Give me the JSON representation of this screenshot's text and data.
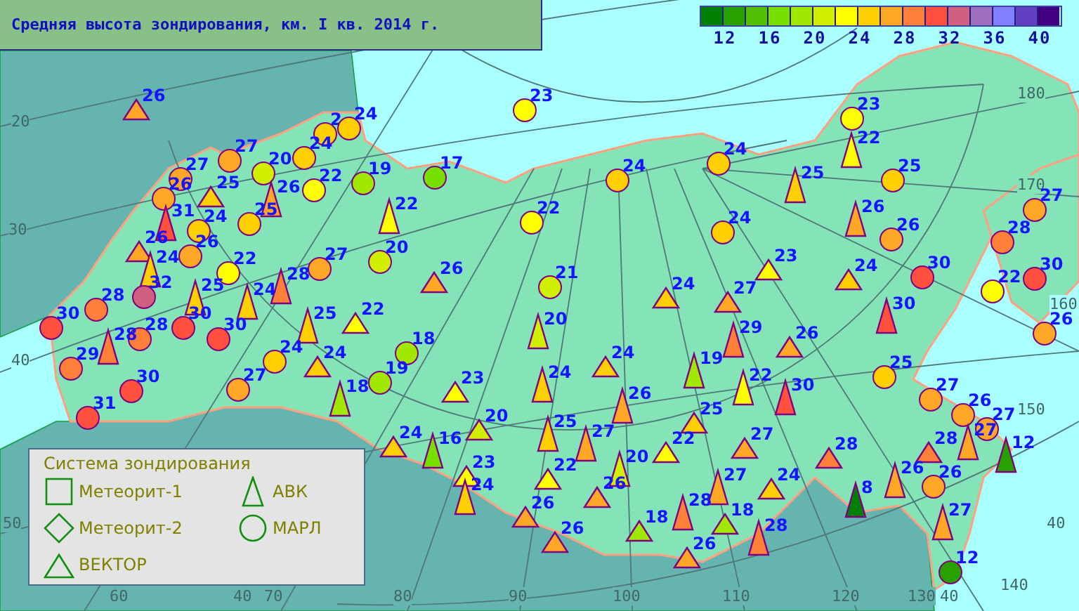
{
  "title": "Средняя высота зондирования, км. I кв. 2014 г.",
  "color_scale": {
    "swatches": [
      {
        "color": "#008000"
      },
      {
        "color": "#28a000"
      },
      {
        "color": "#50c000"
      },
      {
        "color": "#78e000"
      },
      {
        "color": "#a0e800"
      },
      {
        "color": "#d0f000"
      },
      {
        "color": "#ffff00"
      },
      {
        "color": "#ffd000"
      },
      {
        "color": "#ffa828"
      },
      {
        "color": "#ff8038"
      },
      {
        "color": "#ff5040"
      },
      {
        "color": "#d06080"
      },
      {
        "color": "#a070c0"
      },
      {
        "color": "#8080ff"
      },
      {
        "color": "#6040c0"
      },
      {
        "color": "#400080"
      }
    ],
    "labels": [
      "12",
      "16",
      "20",
      "24",
      "28",
      "32",
      "36",
      "40"
    ]
  },
  "grid_labels": [
    "20",
    "30",
    "40",
    "50",
    "60",
    "40",
    "70",
    "80",
    "90",
    "100",
    "110",
    "120",
    "130",
    "40",
    "180",
    "170",
    "160",
    "150",
    "140",
    "40"
  ],
  "stations": [
    {
      "kind": "vektor",
      "value": "26",
      "color": "#ffa828"
    },
    {
      "kind": "marl",
      "value": "2",
      "color": "#ffd000"
    },
    {
      "kind": "marl",
      "value": "24",
      "color": "#ffd000"
    },
    {
      "kind": "marl",
      "value": "23",
      "color": "#ffff00"
    },
    {
      "kind": "marl",
      "value": "27",
      "color": "#ffa828"
    },
    {
      "kind": "marl",
      "value": "20",
      "color": "#d0f000"
    },
    {
      "kind": "marl",
      "value": "24",
      "color": "#ffd000"
    },
    {
      "kind": "marl",
      "value": "27",
      "color": "#ffa828"
    },
    {
      "kind": "marl",
      "value": "26",
      "color": "#ffa828"
    },
    {
      "kind": "vektor",
      "value": "25",
      "color": "#ffd000"
    },
    {
      "kind": "avk",
      "value": "26",
      "color": "#ffa828"
    },
    {
      "kind": "marl",
      "value": "22",
      "color": "#ffff00"
    },
    {
      "kind": "marl",
      "value": "19",
      "color": "#a0e800"
    },
    {
      "kind": "marl",
      "value": "17",
      "color": "#78e000"
    },
    {
      "kind": "avk",
      "value": "31",
      "color": "#ff5040"
    },
    {
      "kind": "marl",
      "value": "24",
      "color": "#ffd000"
    },
    {
      "kind": "marl",
      "value": "25",
      "color": "#ffd000"
    },
    {
      "kind": "avk",
      "value": "22",
      "color": "#ffff00"
    },
    {
      "kind": "marl",
      "value": "22",
      "color": "#ffff00"
    },
    {
      "kind": "vektor",
      "value": "26",
      "color": "#ffa828"
    },
    {
      "kind": "marl",
      "value": "26",
      "color": "#ffa828"
    },
    {
      "kind": "avk",
      "value": "24",
      "color": "#ffd000"
    },
    {
      "kind": "marl",
      "value": "22",
      "color": "#ffff00"
    },
    {
      "kind": "marl",
      "value": "27",
      "color": "#ffa828"
    },
    {
      "kind": "marl",
      "value": "20",
      "color": "#d0f000"
    },
    {
      "kind": "avk",
      "value": "28",
      "color": "#ff8038"
    },
    {
      "kind": "vektor",
      "value": "26",
      "color": "#ffa828"
    },
    {
      "kind": "marl",
      "value": "32",
      "color": "#d06080"
    },
    {
      "kind": "avk",
      "value": "25",
      "color": "#ffd000"
    },
    {
      "kind": "avk",
      "value": "24",
      "color": "#ffd000"
    },
    {
      "kind": "marl",
      "value": "28",
      "color": "#ff8038"
    },
    {
      "kind": "marl",
      "value": "30",
      "color": "#ff5040"
    },
    {
      "kind": "marl",
      "value": "28",
      "color": "#ff8038"
    },
    {
      "kind": "marl",
      "value": "30",
      "color": "#ff5040"
    },
    {
      "kind": "marl",
      "value": "30",
      "color": "#ff5040"
    },
    {
      "kind": "avk",
      "value": "25",
      "color": "#ffd000"
    },
    {
      "kind": "vektor",
      "value": "22",
      "color": "#ffff00"
    },
    {
      "kind": "marl",
      "value": "29",
      "color": "#ff8038"
    },
    {
      "kind": "avk",
      "value": "28",
      "color": "#ff8038"
    },
    {
      "kind": "marl",
      "value": "24",
      "color": "#ffd000"
    },
    {
      "kind": "vektor",
      "value": "24",
      "color": "#ffd000"
    },
    {
      "kind": "marl",
      "value": "18",
      "color": "#a0e800"
    },
    {
      "kind": "marl",
      "value": "30",
      "color": "#ff5040"
    },
    {
      "kind": "marl",
      "value": "27",
      "color": "#ffa828"
    },
    {
      "kind": "marl",
      "value": "19",
      "color": "#a0e800"
    },
    {
      "kind": "avk",
      "value": "18",
      "color": "#a0e800"
    },
    {
      "kind": "vektor",
      "value": "23",
      "color": "#ffff00"
    },
    {
      "kind": "marl",
      "value": "31",
      "color": "#ff5040"
    },
    {
      "kind": "vektor",
      "value": "24",
      "color": "#ffd000"
    },
    {
      "kind": "avk",
      "value": "16",
      "color": "#78e000"
    },
    {
      "kind": "vektor",
      "value": "20",
      "color": "#d0f000"
    },
    {
      "kind": "vektor",
      "value": "23",
      "color": "#ffff00"
    },
    {
      "kind": "avk",
      "value": "24",
      "color": "#ffd000"
    },
    {
      "kind": "vektor",
      "value": "26",
      "color": "#ffa828"
    },
    {
      "kind": "avk",
      "value": "20",
      "color": "#d0f000"
    },
    {
      "kind": "marl",
      "value": "23",
      "color": "#ffff00"
    },
    {
      "kind": "avk",
      "value": "22",
      "color": "#ffff00"
    },
    {
      "kind": "marl",
      "value": "24",
      "color": "#ffd000"
    },
    {
      "kind": "marl",
      "value": "24",
      "color": "#ffd000"
    },
    {
      "kind": "avk",
      "value": "25",
      "color": "#ffd000"
    },
    {
      "kind": "marl",
      "value": "25",
      "color": "#ffd000"
    },
    {
      "kind": "avk",
      "value": "26",
      "color": "#ffa828"
    },
    {
      "kind": "marl",
      "value": "26",
      "color": "#ffa828"
    },
    {
      "kind": "marl",
      "value": "27",
      "color": "#ffa828"
    },
    {
      "kind": "marl",
      "value": "24",
      "color": "#ffd000"
    },
    {
      "kind": "marl",
      "value": "28",
      "color": "#ff8038"
    },
    {
      "kind": "vektor",
      "value": "23",
      "color": "#ffff00"
    },
    {
      "kind": "vektor",
      "value": "24",
      "color": "#ffd000"
    },
    {
      "kind": "marl",
      "value": "30",
      "color": "#ff5040"
    },
    {
      "kind": "marl",
      "value": "22",
      "color": "#ffff00"
    },
    {
      "kind": "marl",
      "value": "30",
      "color": "#ff5040"
    },
    {
      "kind": "marl",
      "value": "21",
      "color": "#d0f000"
    },
    {
      "kind": "vektor",
      "value": "24",
      "color": "#ffd000"
    },
    {
      "kind": "vektor",
      "value": "27",
      "color": "#ffa828"
    },
    {
      "kind": "marl",
      "value": "26",
      "color": "#ffa828"
    },
    {
      "kind": "avk",
      "value": "30",
      "color": "#ff5040"
    },
    {
      "kind": "avk",
      "value": "29",
      "color": "#ff8038"
    },
    {
      "kind": "vektor",
      "value": "26",
      "color": "#ffa828"
    },
    {
      "kind": "vektor",
      "value": "24",
      "color": "#ffd000"
    },
    {
      "kind": "avk",
      "value": "19",
      "color": "#a0e800"
    },
    {
      "kind": "avk",
      "value": "22",
      "color": "#ffff00"
    },
    {
      "kind": "avk",
      "value": "30",
      "color": "#ff5040"
    },
    {
      "kind": "marl",
      "value": "25",
      "color": "#ffd000"
    },
    {
      "kind": "avk",
      "value": "24",
      "color": "#ffd000"
    },
    {
      "kind": "avk",
      "value": "26",
      "color": "#ffa828"
    },
    {
      "kind": "vektor",
      "value": "25",
      "color": "#ffd000"
    },
    {
      "kind": "marl",
      "value": "27",
      "color": "#ffa828"
    },
    {
      "kind": "marl",
      "value": "26",
      "color": "#ffa828"
    },
    {
      "kind": "marl",
      "value": "27",
      "color": "#ffa828"
    },
    {
      "kind": "avk",
      "value": "25",
      "color": "#ffd000"
    },
    {
      "kind": "avk",
      "value": "27",
      "color": "#ffa828"
    },
    {
      "kind": "vektor",
      "value": "22",
      "color": "#ffff00"
    },
    {
      "kind": "vektor",
      "value": "27",
      "color": "#ffa828"
    },
    {
      "kind": "vektor",
      "value": "28",
      "color": "#ff8038"
    },
    {
      "kind": "vektor",
      "value": "28",
      "color": "#ff8038"
    },
    {
      "kind": "avk",
      "value": "27",
      "color": "#ffa828"
    },
    {
      "kind": "avk",
      "value": "12",
      "color": "#28a000"
    },
    {
      "kind": "vektor",
      "value": "22",
      "color": "#ffff00"
    },
    {
      "kind": "avk",
      "value": "20",
      "color": "#d0f000"
    },
    {
      "kind": "vektor",
      "value": "26",
      "color": "#ffa828"
    },
    {
      "kind": "avk",
      "value": "27",
      "color": "#ffa828"
    },
    {
      "kind": "vektor",
      "value": "24",
      "color": "#ffd000"
    },
    {
      "kind": "avk",
      "value": "8",
      "color": "#008000"
    },
    {
      "kind": "avk",
      "value": "26",
      "color": "#ffa828"
    },
    {
      "kind": "marl",
      "value": "26",
      "color": "#ffa828"
    },
    {
      "kind": "vektor",
      "value": "26",
      "color": "#ffa828"
    },
    {
      "kind": "vektor",
      "value": "18",
      "color": "#a0e800"
    },
    {
      "kind": "avk",
      "value": "28",
      "color": "#ff8038"
    },
    {
      "kind": "vektor",
      "value": "18",
      "color": "#a0e800"
    },
    {
      "kind": "avk",
      "value": "28",
      "color": "#ff8038"
    },
    {
      "kind": "vektor",
      "value": "26",
      "color": "#ffa828"
    },
    {
      "kind": "avk",
      "value": "27",
      "color": "#ffa828"
    },
    {
      "kind": "marl",
      "value": "12",
      "color": "#28a000"
    }
  ],
  "legend": {
    "title": "Система зондирования",
    "items": [
      {
        "kind": "square",
        "label": "Метеорит-1"
      },
      {
        "kind": "tall-triangle",
        "label": "АВК"
      },
      {
        "kind": "diamond",
        "label": "Метеорит-2"
      },
      {
        "kind": "circle",
        "label": "МАРЛ"
      },
      {
        "kind": "triangle",
        "label": "ВЕКТОР"
      }
    ]
  }
}
